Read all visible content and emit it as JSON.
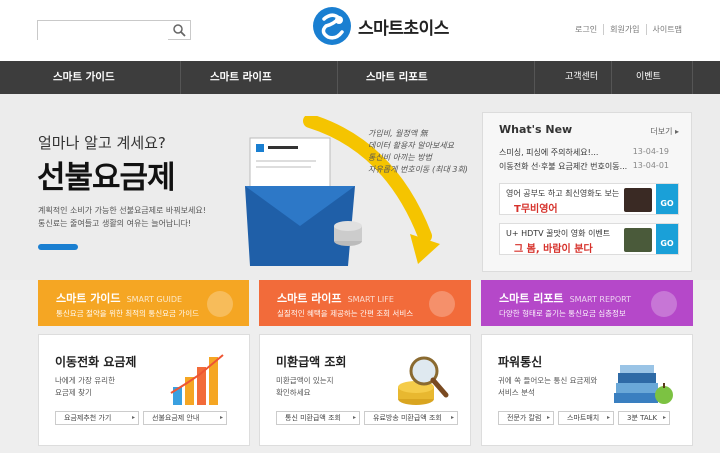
{
  "header": {
    "search_placeholder": "",
    "logo_text": "스마트초이스",
    "links": [
      "로그인",
      "회원가입",
      "사이트맵"
    ]
  },
  "nav": {
    "items": [
      "스마트 가이드",
      "스마트 라이프",
      "스마트 리포트"
    ],
    "right_items": [
      "고객센터",
      "이벤트"
    ]
  },
  "hero": {
    "question": "얼마나 알고 계세요?",
    "title": "선불요금제",
    "desc_line1": "계획적인 소비가 가능한 선불요금제로 바꿔보세요!",
    "desc_line2": "통신료는 줄여들고 생활의 여유는 늘어납니다!",
    "handwriting": [
      "가입비, 월정액 無",
      "데이터 활용자 알아보세요",
      "통신비 아끼는 방법",
      "자유롭게 번호이동 (최대 3회)"
    ]
  },
  "whats_new": {
    "title": "What's New",
    "more": "더보기",
    "items": [
      {
        "text": "스미싱, 피싱에 주의하세요!...",
        "date": "13-04-19"
      },
      {
        "text": "이동전화 선·후불 요금제간 번호이동...",
        "date": "13-04-01"
      }
    ],
    "banners": [
      {
        "line1": "영어 공부도 하고 최신영화도 보는",
        "line2": "T무비영어",
        "go": "GO"
      },
      {
        "line1": "U+ HDTV 꿀맛이 영화 이벤트",
        "line2": "그 봄, 바람이 분다",
        "go": "GO"
      }
    ]
  },
  "categories": [
    {
      "title": "스마트 가이드",
      "eng": "SMART GUIDE",
      "desc": "통신요금 절약을 위한 최적의 통신요금 가이드",
      "color": "#f5a623"
    },
    {
      "title": "스마트 라이프",
      "eng": "SMART LIFE",
      "desc": "실질적인 혜택을 제공하는 간편 조회 서비스",
      "color": "#f26b3a"
    },
    {
      "title": "스마트 리포트",
      "eng": "SMART REPORT",
      "desc": "다양한 형태로 즐기는 통신요금 심층정보",
      "color": "#b548c9"
    }
  ],
  "cards": [
    {
      "title": "이동전화 요금제",
      "desc1": "나에게 가장 유리한",
      "desc2": "요금제 찾기",
      "buttons": [
        "요금제추천 가기",
        "선불요금제 안내"
      ]
    },
    {
      "title": "미환급액 조회",
      "desc1": "미환급액이 있는지",
      "desc2": "확인하세요",
      "buttons": [
        "통신 미환급액 조회",
        "유료방송 미환급액 조회"
      ]
    },
    {
      "title": "파워통신",
      "desc1": "귀에 쏙 들어오는 통신 요금제와",
      "desc2": "서비스 분석",
      "buttons": [
        "전문가 칼럼",
        "스마트매치",
        "3분 TALK"
      ]
    }
  ]
}
